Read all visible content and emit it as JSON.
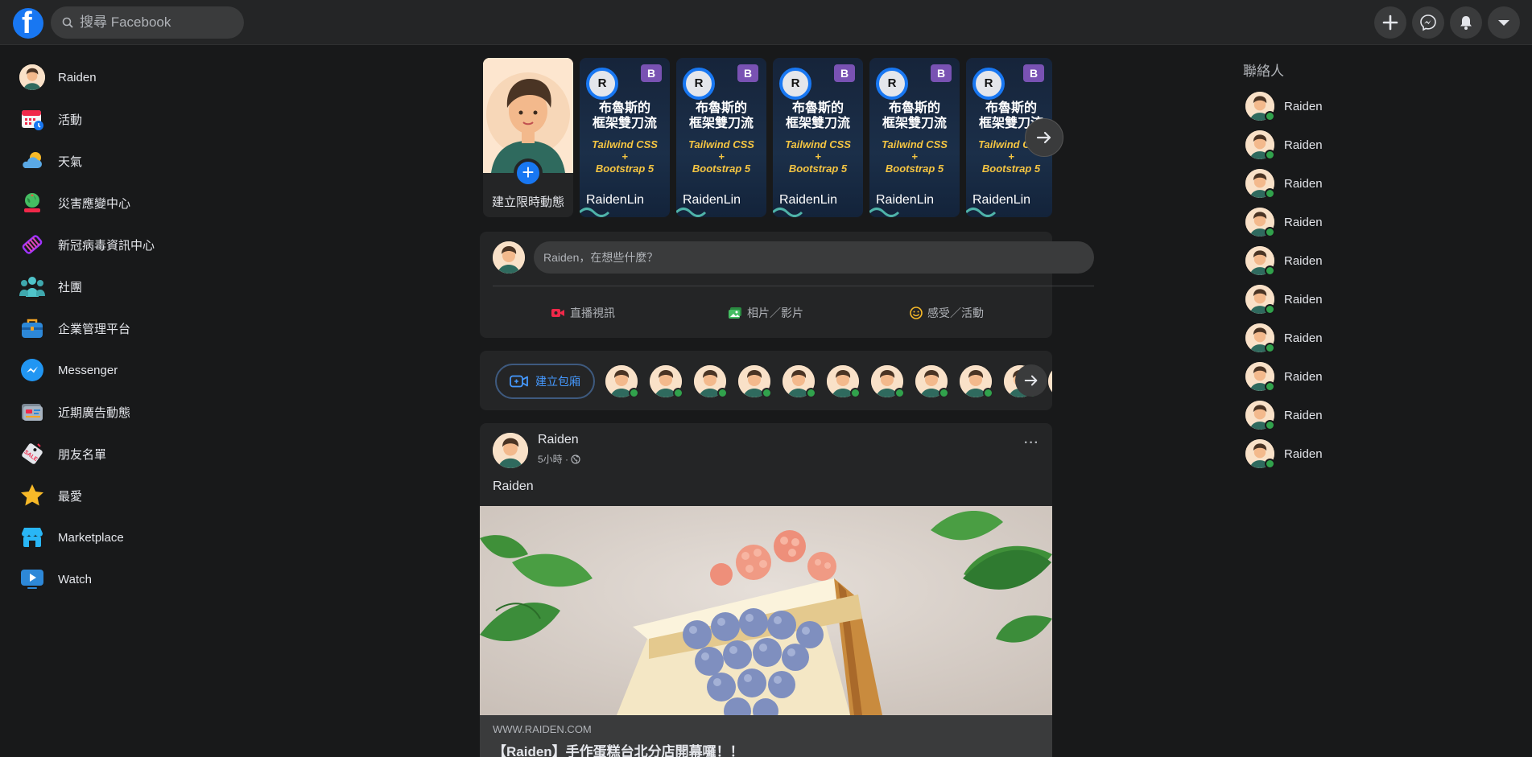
{
  "header": {
    "logo_letter": "f",
    "search_placeholder": "搜尋 Facebook",
    "actions": [
      "create-icon",
      "messenger-icon",
      "notifications-icon",
      "account-menu-icon"
    ]
  },
  "sidebar": {
    "items": [
      {
        "label": "Raiden",
        "icon": "profile-avatar"
      },
      {
        "label": "活動",
        "icon": "calendar-icon"
      },
      {
        "label": "天氣",
        "icon": "weather-icon"
      },
      {
        "label": "災害應變中心",
        "icon": "crisis-response-icon"
      },
      {
        "label": "新冠病毒資訊中心",
        "icon": "covid-info-icon"
      },
      {
        "label": "社團",
        "icon": "groups-icon"
      },
      {
        "label": "企業管理平台",
        "icon": "business-suite-icon"
      },
      {
        "label": "Messenger",
        "icon": "messenger-icon"
      },
      {
        "label": "近期廣告動態",
        "icon": "ad-activity-icon"
      },
      {
        "label": "朋友名單",
        "icon": "friend-lists-icon"
      },
      {
        "label": "最愛",
        "icon": "favorites-star-icon"
      },
      {
        "label": "Marketplace",
        "icon": "marketplace-icon"
      },
      {
        "label": "Watch",
        "icon": "watch-icon"
      }
    ]
  },
  "stories": {
    "create_label": "建立限時動態",
    "items": [
      {
        "avatar_letter": "R",
        "badge": "B",
        "title_line1": "布魯斯的",
        "title_line2": "框架雙刀流",
        "sub_line1": "Tailwind CSS",
        "sub_line2": "+",
        "sub_line3": "Bootstrap 5",
        "name": "RaidenLin"
      },
      {
        "avatar_letter": "R",
        "badge": "B",
        "title_line1": "布魯斯的",
        "title_line2": "框架雙刀流",
        "sub_line1": "Tailwind CSS",
        "sub_line2": "+",
        "sub_line3": "Bootstrap 5",
        "name": "RaidenLin"
      },
      {
        "avatar_letter": "R",
        "badge": "B",
        "title_line1": "布魯斯的",
        "title_line2": "框架雙刀流",
        "sub_line1": "Tailwind CSS",
        "sub_line2": "+",
        "sub_line3": "Bootstrap 5",
        "name": "RaidenLin"
      },
      {
        "avatar_letter": "R",
        "badge": "B",
        "title_line1": "布魯斯的",
        "title_line2": "框架雙刀流",
        "sub_line1": "Tailwind CSS",
        "sub_line2": "+",
        "sub_line3": "Bootstrap 5",
        "name": "RaidenLin"
      },
      {
        "avatar_letter": "R",
        "badge": "B",
        "title_line1": "布魯斯的",
        "title_line2": "框架雙刀流",
        "sub_line1": "Tailwind CSS",
        "sub_line2": "+",
        "sub_line3": "Bootstrap 5",
        "name": "RaidenLin"
      }
    ]
  },
  "composer": {
    "placeholder": "Raiden，在想些什麼？",
    "live_label": "直播視訊",
    "photo_label": "相片／影片",
    "feeling_label": "感受／活動"
  },
  "rooms": {
    "create_label": "建立包廂",
    "online_count_visible": 10
  },
  "post": {
    "author": "Raiden",
    "time": "5小時",
    "privacy_icon": "globe-icon",
    "more": "···",
    "text": "Raiden",
    "link_source": "WWW.RAIDEN.COM",
    "link_title": "【Raiden】手作蛋糕台北分店開幕囉！！"
  },
  "contacts": {
    "title": "聯絡人",
    "items": [
      "Raiden",
      "Raiden",
      "Raiden",
      "Raiden",
      "Raiden",
      "Raiden",
      "Raiden",
      "Raiden",
      "Raiden",
      "Raiden"
    ]
  },
  "colors": {
    "background": "#18191a",
    "surface": "#242526",
    "input": "#3a3b3c",
    "brand": "#1877f2",
    "online": "#31a24c",
    "text": "#e4e6eb",
    "muted": "#b0b3b8"
  }
}
